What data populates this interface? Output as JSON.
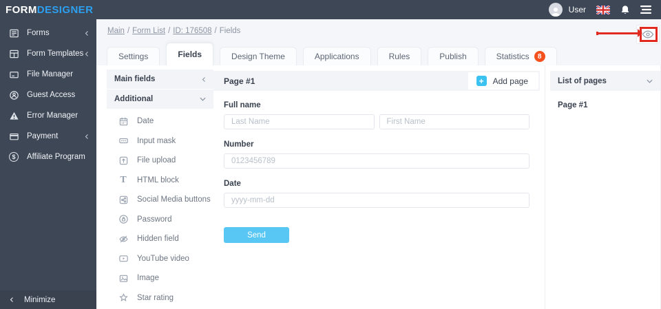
{
  "topbar": {
    "logo": {
      "part1": "FORM",
      "part2": "DESIGNER"
    },
    "user_label": "User"
  },
  "sidebar": {
    "items": [
      {
        "label": "Forms",
        "icon": "forms-icon",
        "expandable": true
      },
      {
        "label": "Form Templates",
        "icon": "form-templates-icon",
        "expandable": true
      },
      {
        "label": "File Manager",
        "icon": "file-manager-icon",
        "expandable": false
      },
      {
        "label": "Guest Access",
        "icon": "guest-access-icon",
        "expandable": false
      },
      {
        "label": "Error Manager",
        "icon": "error-manager-icon",
        "expandable": false
      },
      {
        "label": "Payment",
        "icon": "payment-icon",
        "expandable": true
      },
      {
        "label": "Affiliate Program",
        "icon": "affiliate-icon",
        "expandable": false
      }
    ],
    "minimize_label": "Minimize"
  },
  "breadcrumb": {
    "links": [
      "Main",
      "Form List",
      "ID: 176508"
    ],
    "current": "Fields",
    "separator": "/"
  },
  "tabs": [
    {
      "label": "Settings",
      "active": false
    },
    {
      "label": "Fields",
      "active": true
    },
    {
      "label": "Design Theme",
      "active": false
    },
    {
      "label": "Applications",
      "active": false
    },
    {
      "label": "Rules",
      "active": false
    },
    {
      "label": "Publish",
      "active": false
    },
    {
      "label": "Statistics",
      "active": false,
      "badge": "8"
    }
  ],
  "fields_panel": {
    "groups": [
      {
        "label": "Main fields",
        "state": "collapsed"
      },
      {
        "label": "Additional",
        "state": "expanded"
      }
    ],
    "items": [
      {
        "label": "Date",
        "icon": "calendar-icon"
      },
      {
        "label": "Input mask",
        "icon": "input-mask-icon"
      },
      {
        "label": "File upload",
        "icon": "file-upload-icon"
      },
      {
        "label": "HTML block",
        "icon": "html-block-icon"
      },
      {
        "label": "Social Media buttons",
        "icon": "share-icon"
      },
      {
        "label": "Password",
        "icon": "password-icon"
      },
      {
        "label": "Hidden field",
        "icon": "eye-off-icon"
      },
      {
        "label": "YouTube video",
        "icon": "youtube-video-icon"
      },
      {
        "label": "Image",
        "icon": "image-icon"
      },
      {
        "label": "Star rating",
        "icon": "star-icon"
      }
    ]
  },
  "canvas": {
    "page_header": "Page #1",
    "add_page_label": "Add page",
    "form": {
      "full_name_label": "Full name",
      "last_name_placeholder": "Last Name",
      "first_name_placeholder": "First Name",
      "number_label": "Number",
      "number_placeholder": "0123456789",
      "date_label": "Date",
      "date_placeholder": "yyyy-mm-dd",
      "send_label": "Send"
    }
  },
  "pages_panel": {
    "title": "List of pages",
    "pages": [
      "Page #1"
    ]
  },
  "glyphs": {
    "plus": "+",
    "t_icon": "T",
    "dollar": "$"
  },
  "colors": {
    "topbar_bg": "#3e4755",
    "logo_blue": "#2d9ff0",
    "band_bg": "#f5f6f9",
    "panel_bg": "#f3f4f7",
    "send_blue": "#58c7f3",
    "add_page_blue": "#3cc2f0",
    "badge_orange": "#f4511e",
    "annotation_red": "#e12b20"
  },
  "annotation": {
    "type": "red-arrow-and-box",
    "target": "preview-eye-button"
  }
}
